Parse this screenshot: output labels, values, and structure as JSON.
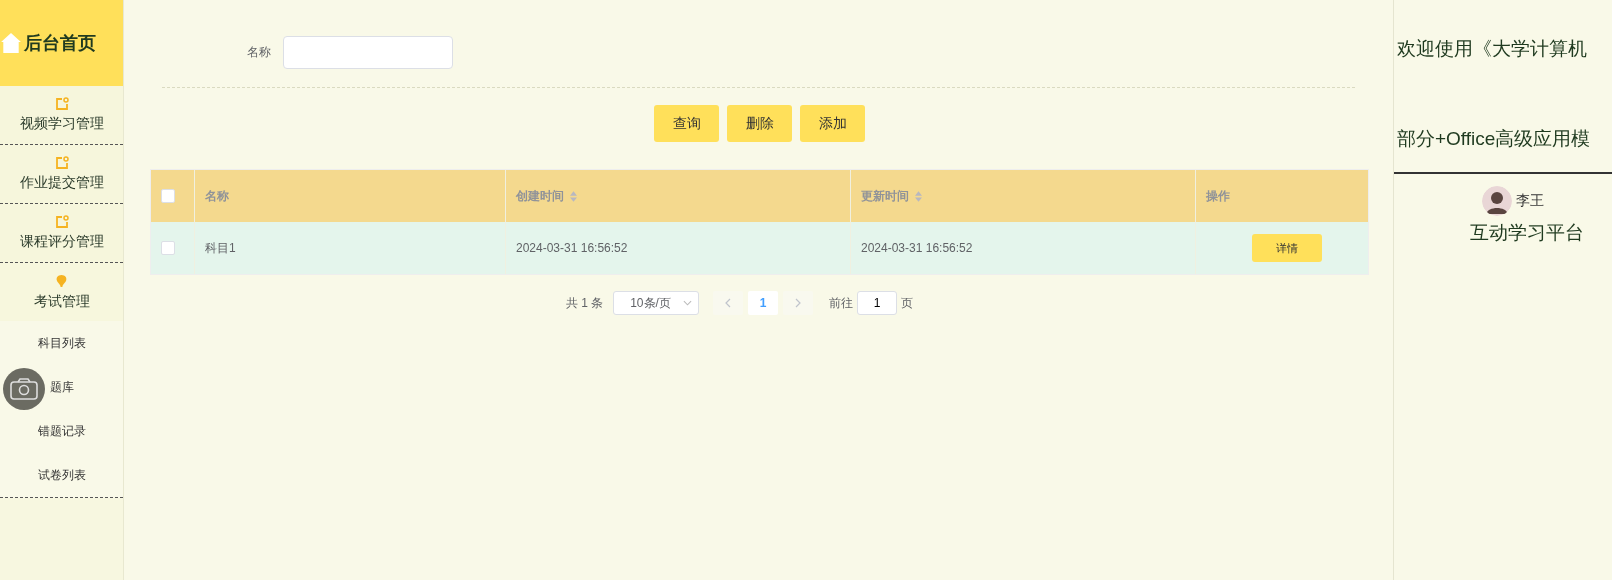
{
  "sidebar": {
    "home": "后台首页",
    "items": [
      {
        "label": "视频学习管理",
        "kind": "folder",
        "expanded": false
      },
      {
        "label": "作业提交管理",
        "kind": "folder",
        "expanded": false
      },
      {
        "label": "课程评分管理",
        "kind": "folder",
        "expanded": false
      },
      {
        "label": "考试管理",
        "kind": "bulb",
        "expanded": true,
        "children": [
          {
            "label": "科目列表"
          },
          {
            "label": "题库"
          },
          {
            "label": "错题记录"
          },
          {
            "label": "试卷列表"
          }
        ]
      }
    ]
  },
  "search": {
    "label": "名称"
  },
  "buttons": [
    "查询",
    "删除",
    "添加"
  ],
  "table": {
    "columns": [
      {
        "label": "名称",
        "sortable": false
      },
      {
        "label": "创建时间",
        "sortable": true
      },
      {
        "label": "更新时间",
        "sortable": true
      },
      {
        "label": "操作",
        "sortable": false
      }
    ],
    "header_checked": false,
    "rows": [
      {
        "checked": false,
        "cells": [
          "科目1",
          "2024-03-31 16:56:52",
          "2024-03-31 16:56:52"
        ],
        "action": "详情"
      }
    ]
  },
  "pagination": {
    "total": "共 1 条",
    "page_size": "10条/页",
    "pages": [
      {
        "label": "1",
        "selected": true
      }
    ],
    "goto_label": "前往",
    "goto_value": "1",
    "goto_unit": "页"
  },
  "right_panel": {
    "title_lines": [
      "欢迎使用《大学计算机",
      "部分+Office高级应用模"
    ],
    "user": "李王",
    "subtitle": "互动学习平台"
  }
}
